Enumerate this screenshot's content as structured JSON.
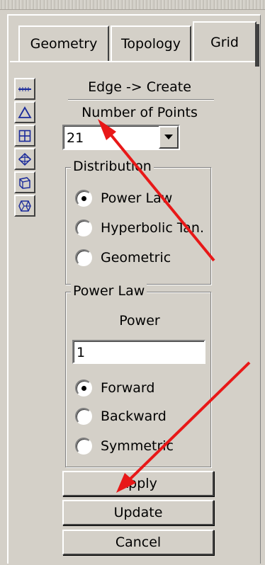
{
  "tabs": [
    "Geometry",
    "Topology",
    "Grid"
  ],
  "active_tab": "Grid",
  "toolbar_icons": [
    "edge-icon",
    "triangle-icon",
    "grid-icon",
    "sphere-icon",
    "cube-icon",
    "polyhedron-icon"
  ],
  "panel": {
    "title": "Edge -> Create",
    "number_of_points_label": "Number of Points",
    "number_of_points_value": "21"
  },
  "distribution": {
    "legend": "Distribution",
    "options": [
      "Power Law",
      "Hyperbolic Tan.",
      "Geometric"
    ],
    "selected": "Power Law"
  },
  "power_law": {
    "legend": "Power Law",
    "power_label": "Power",
    "power_value": "1",
    "direction_options": [
      "Forward",
      "Backward",
      "Symmetric"
    ],
    "selected": "Forward"
  },
  "buttons": {
    "apply": "Apply",
    "update": "Update",
    "cancel": "Cancel"
  },
  "annotation_color": "#e81818"
}
